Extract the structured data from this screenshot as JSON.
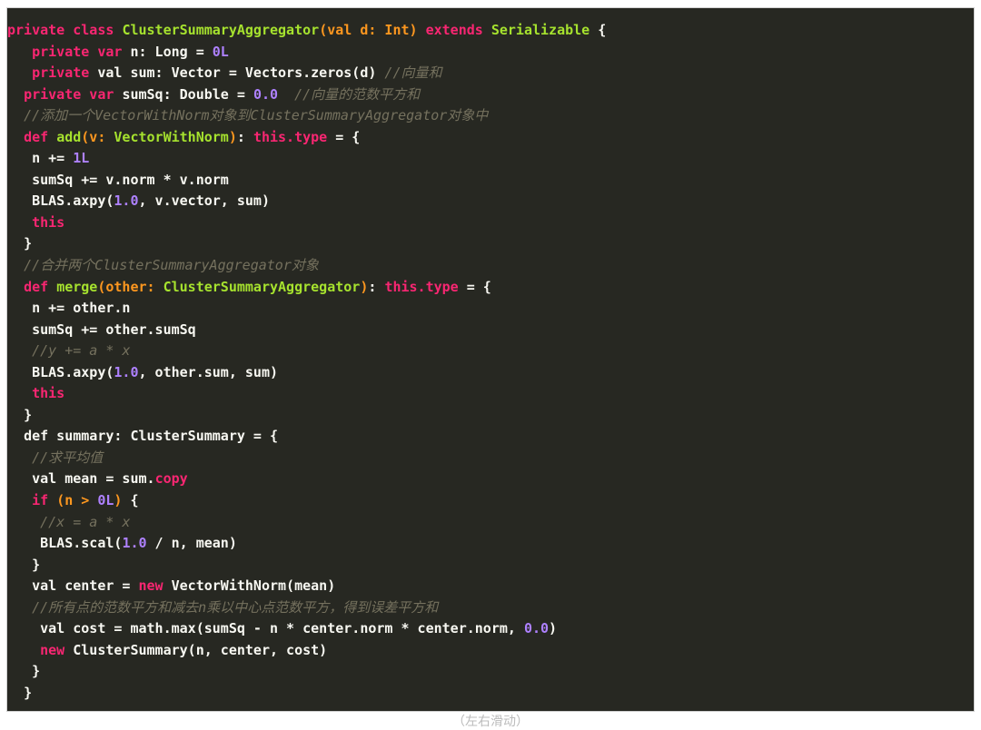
{
  "editor": {
    "lines": [
      {
        "indent": "",
        "tokens": [
          [
            "kw",
            "private class "
          ],
          [
            "cls",
            "ClusterSummaryAggregator"
          ],
          [
            "param",
            "(val d: Int) "
          ],
          [
            "kw",
            "extends "
          ],
          [
            "cls",
            "Serializable"
          ],
          [
            "plain",
            " {"
          ]
        ]
      },
      {
        "indent": "   ",
        "tokens": [
          [
            "kw",
            "private var "
          ],
          [
            "plain",
            "n: Long = "
          ],
          [
            "num",
            "0L"
          ]
        ]
      },
      {
        "indent": "   ",
        "tokens": [
          [
            "kw",
            "private "
          ],
          [
            "plain",
            "val sum: Vector = Vectors.zeros(d) "
          ],
          [
            "cm",
            "//向量和"
          ]
        ]
      },
      {
        "indent": "  ",
        "tokens": [
          [
            "kw",
            "private var "
          ],
          [
            "plain",
            "sumSq: Double = "
          ],
          [
            "num",
            "0.0"
          ],
          [
            "plain",
            "  "
          ],
          [
            "cm",
            "//向量的范数平方和"
          ]
        ]
      },
      {
        "indent": "  ",
        "tokens": [
          [
            "cm",
            "//添加一个VectorWithNorm对象到ClusterSummaryAggregator对象中"
          ]
        ]
      },
      {
        "indent": "  ",
        "tokens": [
          [
            "kw",
            "def "
          ],
          [
            "cls",
            "add"
          ],
          [
            "param",
            "(v: "
          ],
          [
            "cls",
            "VectorWithNorm"
          ],
          [
            "param",
            ")"
          ],
          [
            "plain",
            ": "
          ],
          [
            "kw",
            "this.type"
          ],
          [
            "plain",
            " = {"
          ]
        ]
      },
      {
        "indent": "   ",
        "tokens": [
          [
            "plain",
            "n += "
          ],
          [
            "num",
            "1L"
          ]
        ]
      },
      {
        "indent": "   ",
        "tokens": [
          [
            "plain",
            "sumSq += v.norm * v.norm"
          ]
        ]
      },
      {
        "indent": "   ",
        "tokens": [
          [
            "plain",
            "BLAS.axpy("
          ],
          [
            "num",
            "1.0"
          ],
          [
            "plain",
            ", v.vector, sum)"
          ]
        ]
      },
      {
        "indent": "   ",
        "tokens": [
          [
            "kw",
            "this"
          ]
        ]
      },
      {
        "indent": "  ",
        "tokens": [
          [
            "plain",
            "}"
          ]
        ]
      },
      {
        "indent": "  ",
        "tokens": [
          [
            "cm",
            "//合并两个ClusterSummaryAggregator对象"
          ]
        ]
      },
      {
        "indent": "  ",
        "tokens": [
          [
            "kw",
            "def "
          ],
          [
            "cls",
            "merge"
          ],
          [
            "param",
            "(other: "
          ],
          [
            "cls",
            "ClusterSummaryAggregator"
          ],
          [
            "param",
            ")"
          ],
          [
            "plain",
            ": "
          ],
          [
            "kw",
            "this.type"
          ],
          [
            "plain",
            " = {"
          ]
        ]
      },
      {
        "indent": "   ",
        "tokens": [
          [
            "plain",
            "n += other.n"
          ]
        ]
      },
      {
        "indent": "   ",
        "tokens": [
          [
            "plain",
            "sumSq += other.sumSq"
          ]
        ]
      },
      {
        "indent": "   ",
        "tokens": [
          [
            "cm",
            "//y += a * x"
          ]
        ]
      },
      {
        "indent": "   ",
        "tokens": [
          [
            "plain",
            "BLAS.axpy("
          ],
          [
            "num",
            "1.0"
          ],
          [
            "plain",
            ", other.sum, sum)"
          ]
        ]
      },
      {
        "indent": "   ",
        "tokens": [
          [
            "kw",
            "this"
          ]
        ]
      },
      {
        "indent": "  ",
        "tokens": [
          [
            "plain",
            "}"
          ]
        ]
      },
      {
        "indent": "  ",
        "tokens": [
          [
            "plain",
            "def summary: ClusterSummary = {"
          ]
        ]
      },
      {
        "indent": "   ",
        "tokens": [
          [
            "cm",
            "//求平均值"
          ]
        ]
      },
      {
        "indent": "   ",
        "tokens": [
          [
            "plain",
            "val mean = sum."
          ],
          [
            "kw",
            "copy"
          ]
        ]
      },
      {
        "indent": "   ",
        "tokens": [
          [
            "kw",
            "if "
          ],
          [
            "param",
            "(n > "
          ],
          [
            "num",
            "0L"
          ],
          [
            "param",
            ")"
          ],
          [
            "plain",
            " {"
          ]
        ]
      },
      {
        "indent": "    ",
        "tokens": [
          [
            "cm",
            "//x = a * x"
          ]
        ]
      },
      {
        "indent": "    ",
        "tokens": [
          [
            "plain",
            "BLAS.scal("
          ],
          [
            "num",
            "1.0"
          ],
          [
            "plain",
            " / n, mean)"
          ]
        ]
      },
      {
        "indent": "   ",
        "tokens": [
          [
            "plain",
            "}"
          ]
        ]
      },
      {
        "indent": "   ",
        "tokens": [
          [
            "plain",
            "val center = "
          ],
          [
            "kw",
            "new "
          ],
          [
            "plain",
            "VectorWithNorm(mean)"
          ]
        ]
      },
      {
        "indent": "   ",
        "tokens": [
          [
            "cm",
            "//所有点的范数平方和减去n乘以中心点范数平方，得到误差平方和"
          ]
        ]
      },
      {
        "indent": "    ",
        "tokens": [
          [
            "plain",
            "val cost = math.max(sumSq - n * center.norm * center.norm, "
          ],
          [
            "num",
            "0.0"
          ],
          [
            "plain",
            ")"
          ]
        ]
      },
      {
        "indent": "    ",
        "tokens": [
          [
            "kw",
            "new "
          ],
          [
            "plain",
            "ClusterSummary(n, center, cost)"
          ]
        ]
      },
      {
        "indent": "   ",
        "tokens": [
          [
            "plain",
            "}"
          ]
        ]
      },
      {
        "indent": "  ",
        "tokens": [
          [
            "plain",
            "}"
          ]
        ]
      }
    ]
  },
  "caption": {
    "text": "（左右滑动）"
  }
}
